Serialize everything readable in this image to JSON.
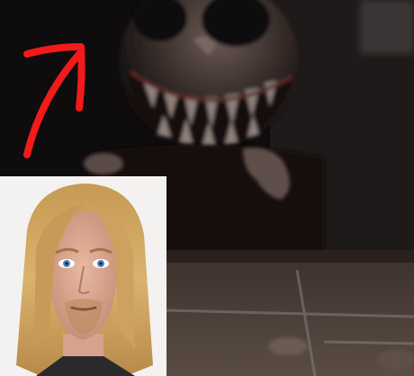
{
  "meme": {
    "background_image": {
      "subject": "dark-blurry-creature-with-grinning-teeth",
      "tone": "low-light"
    },
    "inset_photo": {
      "subject": "portrait-long-blond-hair-blue-eyes"
    },
    "annotation": {
      "kind": "hand-drawn-arrow",
      "color": "#f11b1b",
      "direction": "up-right"
    }
  }
}
